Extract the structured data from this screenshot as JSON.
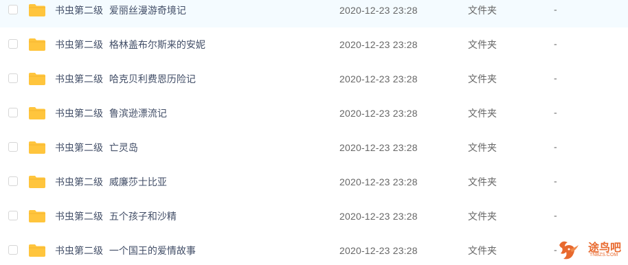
{
  "files": [
    {
      "name": "书虫第二级  爱丽丝漫游奇境记",
      "date": "2020-12-23 23:28",
      "type": "文件夹",
      "size": "-"
    },
    {
      "name": "书虫第二级  格林盖布尔斯来的安妮",
      "date": "2020-12-23 23:28",
      "type": "文件夹",
      "size": "-"
    },
    {
      "name": "书虫第二级  哈克贝利费恩历险记",
      "date": "2020-12-23 23:28",
      "type": "文件夹",
      "size": "-"
    },
    {
      "name": "书虫第二级  鲁滨逊漂流记",
      "date": "2020-12-23 23:28",
      "type": "文件夹",
      "size": "-"
    },
    {
      "name": "书虫第二级  亡灵岛",
      "date": "2020-12-23 23:28",
      "type": "文件夹",
      "size": "-"
    },
    {
      "name": "书虫第二级  威廉莎士比亚",
      "date": "2020-12-23 23:28",
      "type": "文件夹",
      "size": "-"
    },
    {
      "name": "书虫第二级  五个孩子和沙精",
      "date": "2020-12-23 23:28",
      "type": "文件夹",
      "size": "-"
    },
    {
      "name": "书虫第二级  一个国王的爱情故事",
      "date": "2020-12-23 23:28",
      "type": "文件夹",
      "size": "-"
    }
  ],
  "icons": {
    "folder": "folder-icon",
    "checkbox": "checkbox"
  },
  "colors": {
    "folder": "#ffc53d",
    "folder_tab": "#f5b52e",
    "text": "#424e67",
    "muted": "#666666",
    "watermark": "#e8692e"
  },
  "watermark": {
    "text": "途鸟吧",
    "sub": "TNBZS.COM"
  }
}
